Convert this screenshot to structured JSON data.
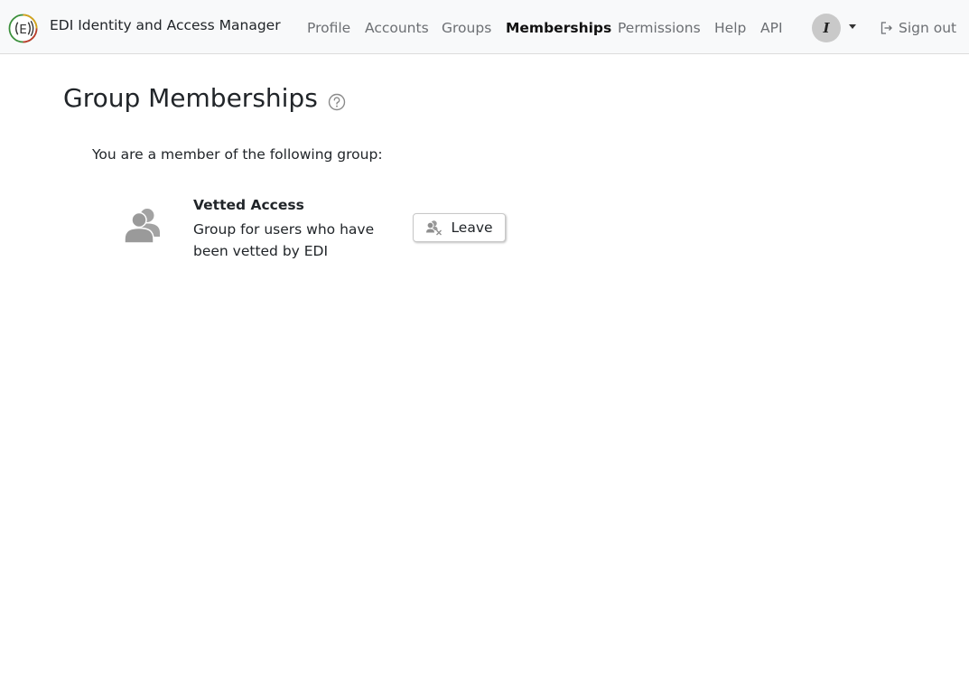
{
  "app": {
    "title": "EDI Identity and Access Manager"
  },
  "nav": {
    "items": [
      {
        "label": "Profile",
        "active": false
      },
      {
        "label": "Accounts",
        "active": false
      },
      {
        "label": "Groups",
        "active": false
      },
      {
        "label": "Memberships",
        "active": true
      },
      {
        "label": "Permissions",
        "active": false
      },
      {
        "label": "Help",
        "active": false
      },
      {
        "label": "API",
        "active": false
      }
    ],
    "avatar_initial": "I",
    "signout_label": "Sign out"
  },
  "main": {
    "title": "Group Memberships",
    "intro": "You are a member of the following group:",
    "groups": [
      {
        "name": "Vetted Access",
        "description": "Group for users who have been vetted by EDI",
        "leave_label": "Leave"
      }
    ]
  },
  "icons": {
    "logo": "edi-logo-icon",
    "help": "question-circle-icon",
    "group": "users-icon",
    "leave": "user-remove-icon",
    "signout": "sign-out-icon",
    "dropdown": "caret-down-icon"
  },
  "colors": {
    "navbar_bg": "#f8f9fa",
    "nav_text": "#6c6f73",
    "nav_active": "#111111",
    "icon_gray": "#9a9a9a",
    "avatar_bg": "#c9c9c9"
  }
}
